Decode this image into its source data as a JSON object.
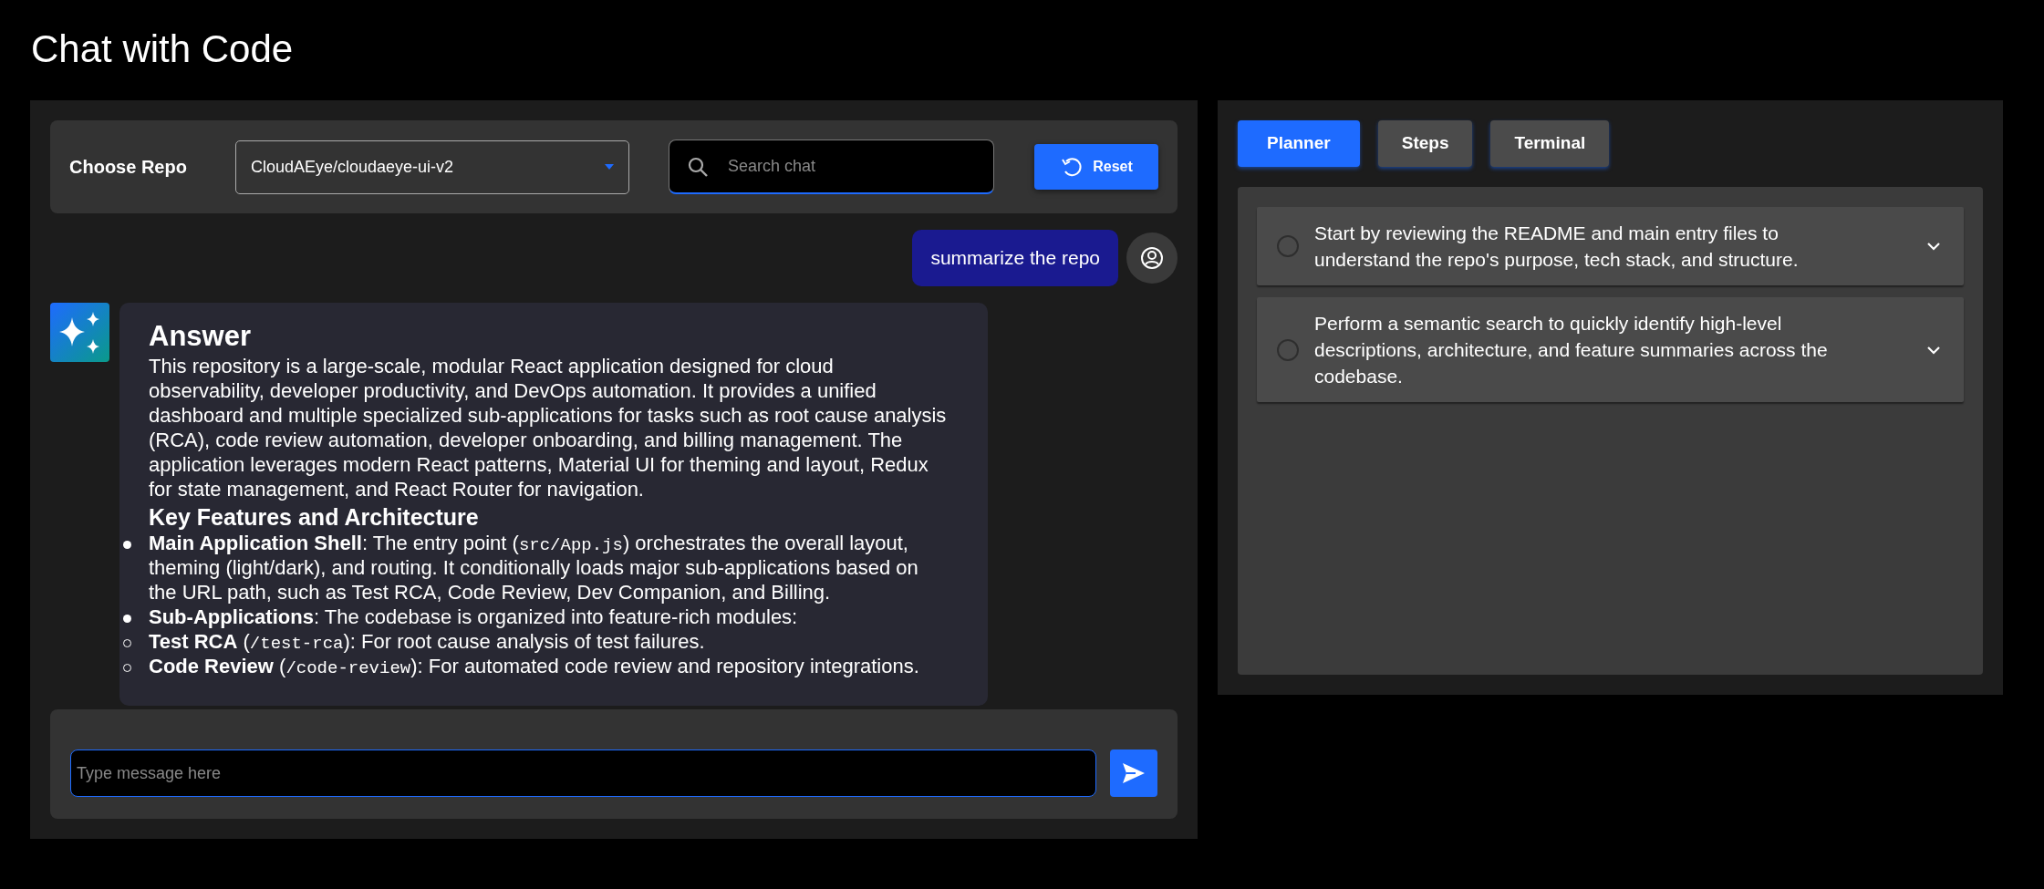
{
  "title": "Chat with Code",
  "repo_bar": {
    "label": "Choose Repo",
    "repo_select": {
      "value": "CloudAEye/cloudaeye-ui-v2"
    },
    "search": {
      "placeholder": "Search chat"
    },
    "reset_button": "Reset"
  },
  "messages": [
    {
      "kind": "user",
      "text": "summarize the repo"
    },
    {
      "kind": "answer",
      "heading": "Answer",
      "paragraph": "This repository is a large-scale, modular React application designed for cloud observability, developer productivity, and DevOps automation. It provides a unified dashboard and multiple specialized sub-applications for tasks such as root cause analysis (RCA), code review automation, developer onboarding, and billing management. The application leverages modern React patterns, Material UI for theming and layout, Redux for state management, and React Router for navigation.",
      "subheading": "Key Features and Architecture",
      "bullets": [
        {
          "kind": "disc",
          "lead": "Main Application Shell",
          "pre": ": The entry point (",
          "code": "src/App.js",
          "post": ") orchestrates the overall layout, theming (light/dark), and routing. It conditionally loads major sub-applications based on the URL path, such as Test RCA, Code Review, Dev Companion, and Billing."
        },
        {
          "kind": "disc",
          "lead": "Sub-Applications",
          "pre": ": The codebase is organized into feature-rich modules:"
        },
        {
          "kind": "circle",
          "lead": "Test RCA",
          "pre": " (",
          "code": "/test-rca",
          "post": "): For root cause analysis of test failures."
        },
        {
          "kind": "circle",
          "lead": "Code Review",
          "pre": " (",
          "code": "/code-review",
          "post": "): For automated code review and repository integrations."
        }
      ]
    }
  ],
  "composer": {
    "placeholder": "Type message here"
  },
  "tabs": [
    {
      "label": "Planner",
      "selected": true
    },
    {
      "label": "Steps",
      "selected": false
    },
    {
      "label": "Terminal",
      "selected": false
    }
  ],
  "plan_steps": [
    {
      "text": "Start by reviewing the README and main entry files to understand the repo's purpose, tech stack, and structure.",
      "checked": false,
      "expanded": false
    },
    {
      "text": "Perform a semantic search to quickly identify high-level descriptions, architecture, and feature summaries across the codebase.",
      "checked": false,
      "expanded": false
    }
  ]
}
